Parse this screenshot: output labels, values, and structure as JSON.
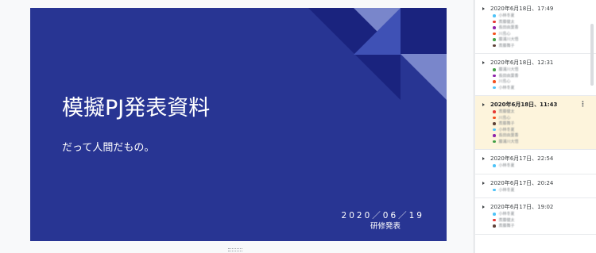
{
  "colors": {
    "slide_bg": "#283593",
    "shape_dark": "#1a237e",
    "shape_mid": "#3f51b5",
    "shape_light": "#7986cb",
    "selected_bg": "#fdf4dc"
  },
  "slide": {
    "title": "模擬PJ発表資料",
    "subtitle": "だって人間だもの。",
    "date": "2020／06／19",
    "event": "研修発表"
  },
  "history": {
    "versions": [
      {
        "timestamp": "2020年6月18日、17:49",
        "selected": false,
        "editors": [
          {
            "name": "小林冬夏",
            "color": "#4fc3f7"
          },
          {
            "name": "斎藤健太",
            "color": "#e53935"
          },
          {
            "name": "長田由葉香",
            "color": "#8e24aa"
          },
          {
            "name": "川島心",
            "color": "#f4511e"
          },
          {
            "name": "藤浦川大悟",
            "color": "#43a047"
          },
          {
            "name": "斎藤舞子",
            "color": "#5d4037"
          }
        ]
      },
      {
        "timestamp": "2020年6月18日、12:31",
        "selected": false,
        "editors": [
          {
            "name": "藤浦川大悟",
            "color": "#43a047"
          },
          {
            "name": "長田由葉香",
            "color": "#8e24aa"
          },
          {
            "name": "川島心",
            "color": "#f4511e"
          },
          {
            "name": "小林冬夏",
            "color": "#4fc3f7"
          }
        ]
      },
      {
        "timestamp": "2020年6月18日、11:43",
        "selected": true,
        "more_icon": "⋮",
        "editors": [
          {
            "name": "斎藤健太",
            "color": "#e53935"
          },
          {
            "name": "川島心",
            "color": "#f4511e"
          },
          {
            "name": "斎藤舞子",
            "color": "#5d4037"
          },
          {
            "name": "小林冬夏",
            "color": "#4fc3f7"
          },
          {
            "name": "長田由葉香",
            "color": "#8e24aa"
          },
          {
            "name": "藤浦川大悟",
            "color": "#43a047"
          }
        ]
      },
      {
        "timestamp": "2020年6月17日、22:54",
        "selected": false,
        "editors": [
          {
            "name": "小林冬夏",
            "color": "#4fc3f7"
          }
        ]
      },
      {
        "timestamp": "2020年6月17日、20:24",
        "selected": false,
        "editors": [
          {
            "name": "小林冬夏",
            "color": "#4fc3f7"
          }
        ]
      },
      {
        "timestamp": "2020年6月17日、19:02",
        "selected": false,
        "editors": [
          {
            "name": "小林冬夏",
            "color": "#4fc3f7"
          },
          {
            "name": "斎藤健太",
            "color": "#e53935"
          },
          {
            "name": "斎藤舞子",
            "color": "#5d4037"
          }
        ]
      }
    ]
  }
}
